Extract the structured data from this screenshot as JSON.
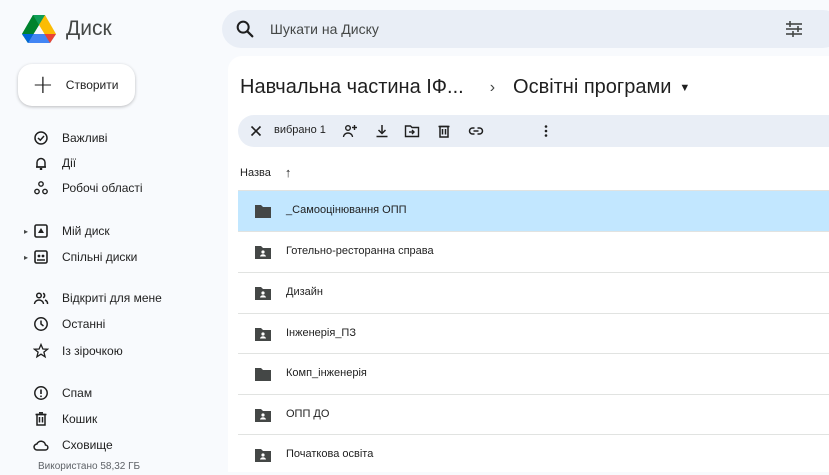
{
  "app": {
    "title": "Диск"
  },
  "search": {
    "placeholder": "Шукати на Диску"
  },
  "create_label": "Створити",
  "sidebar": {
    "items": [
      {
        "label": "Важливі",
        "icon": "priority-icon"
      },
      {
        "label": "Дії",
        "icon": "bell-icon"
      },
      {
        "label": "Робочі області",
        "icon": "workspaces-icon"
      },
      {
        "label": "Мій диск",
        "icon": "my-drive-icon"
      },
      {
        "label": "Спільні диски",
        "icon": "shared-drives-icon"
      },
      {
        "label": "Відкриті для мене",
        "icon": "shared-with-me-icon"
      },
      {
        "label": "Останні",
        "icon": "clock-icon"
      },
      {
        "label": "Із зірочкою",
        "icon": "star-icon"
      },
      {
        "label": "Спам",
        "icon": "spam-icon"
      },
      {
        "label": "Кошик",
        "icon": "trash-icon"
      },
      {
        "label": "Сховище",
        "icon": "cloud-icon"
      }
    ],
    "storage_used": "Використано 58,32 ГБ"
  },
  "breadcrumb": {
    "parent": "Навчальна частина ІФ...",
    "separator": "›",
    "current": "Освітні програми"
  },
  "selection": {
    "count_label": "вибрано 1"
  },
  "table": {
    "header_name": "Назва",
    "sort_arrow": "↑"
  },
  "files": [
    {
      "name": "_Самооцінювання ОПП",
      "type": "folder",
      "selected": true
    },
    {
      "name": "Готельно-ресторанна справа",
      "type": "shared-folder",
      "selected": false
    },
    {
      "name": "Дизайн",
      "type": "shared-folder",
      "selected": false
    },
    {
      "name": "Інженерія_ПЗ",
      "type": "shared-folder",
      "selected": false
    },
    {
      "name": "Комп_інженерія",
      "type": "folder",
      "selected": false
    },
    {
      "name": "ОПП ДО",
      "type": "shared-folder",
      "selected": false
    },
    {
      "name": "Початкова освіта",
      "type": "shared-folder",
      "selected": false
    }
  ],
  "colors": {
    "selected_row": "#c2e7ff",
    "search_bg": "#e9eef6",
    "page_bg": "#f8fafd"
  }
}
